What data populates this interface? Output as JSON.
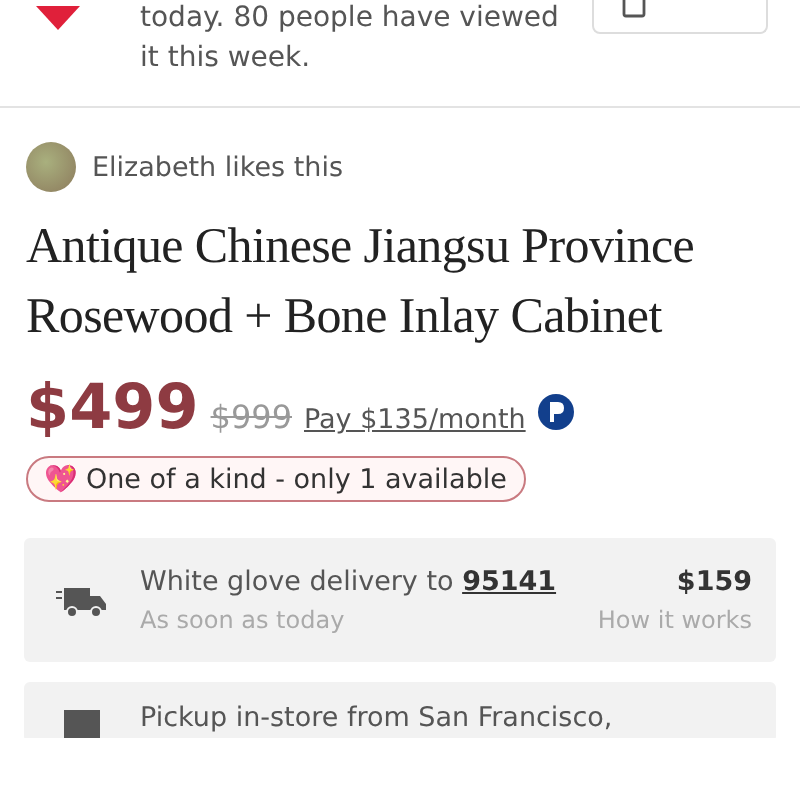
{
  "views_notice": {
    "lines": [
      "today. 80 people have viewed",
      "it this week."
    ]
  },
  "liked_by": {
    "text": "Elizabeth likes this"
  },
  "title": "Antique Chinese Jiangsu Province Rosewood + Bone Inlay Cabinet",
  "price": {
    "current": "$499",
    "original": "$999",
    "financing": "Pay $135/month"
  },
  "badge": {
    "emoji": "💖",
    "text": "One of a kind - only 1 available"
  },
  "delivery_options": [
    {
      "kind": "delivery",
      "title": "White glove delivery to **95141**",
      "subtitle": "As soon as today",
      "price": "$159",
      "link": "How it works"
    },
    {
      "kind": "pickup",
      "title": "Pickup in-store from San Francisco,"
    }
  ]
}
